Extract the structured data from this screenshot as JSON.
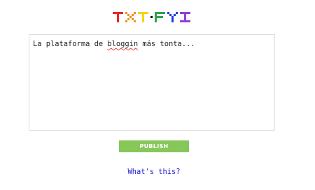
{
  "logo": {
    "text": "TXT·FYI",
    "colors": {
      "T1": "#e8262b",
      "X": "#f28f1e",
      "T2": "#f5d515",
      "dot": "#111111",
      "F": "#2aa64a",
      "Y": "#1f3ce0",
      "I": "#9a3bd8"
    }
  },
  "editor": {
    "text_before": "La plataforma de ",
    "text_misspelled": "bloggin",
    "text_after": " más tonta..."
  },
  "publish_button": {
    "label": "PUBLISH",
    "color": "#87c75a"
  },
  "help_link": {
    "label": "What's this?",
    "color": "#1a1ad6"
  }
}
